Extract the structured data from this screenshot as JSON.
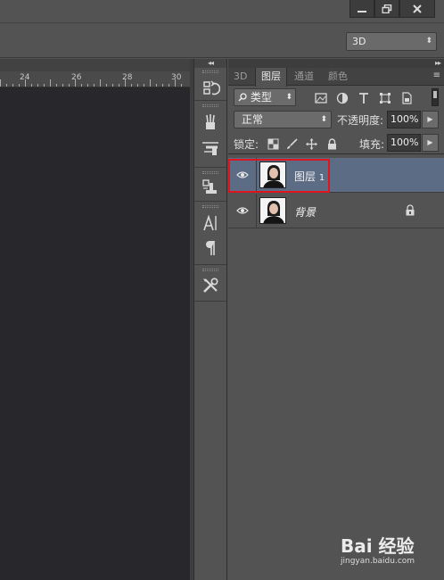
{
  "window": {
    "workspace": "3D"
  },
  "ruler": {
    "marks": [
      "24",
      "26",
      "28",
      "30"
    ]
  },
  "layers_panel": {
    "tabs": [
      "3D",
      "图层",
      "通道",
      "颜色"
    ],
    "active_tab": "图层",
    "filter": {
      "kind": "类型"
    },
    "blend_mode": "正常",
    "opacity_label": "不透明度:",
    "opacity_value": "100%",
    "lock_label": "锁定:",
    "fill_label": "填充:",
    "fill_value": "100%",
    "layers": [
      {
        "name": "图层",
        "suffix": "1",
        "visible": true,
        "selected": true,
        "locked": false
      },
      {
        "name": "背景",
        "visible": true,
        "selected": false,
        "locked": true
      }
    ]
  },
  "watermark": {
    "logo": "Bai 经验",
    "url": "jingyan.baidu.com"
  },
  "colors": {
    "selection": "#5d6c85",
    "highlight": "#e0141e",
    "panel_bg": "#535353",
    "canvas_bg": "#28272b"
  }
}
